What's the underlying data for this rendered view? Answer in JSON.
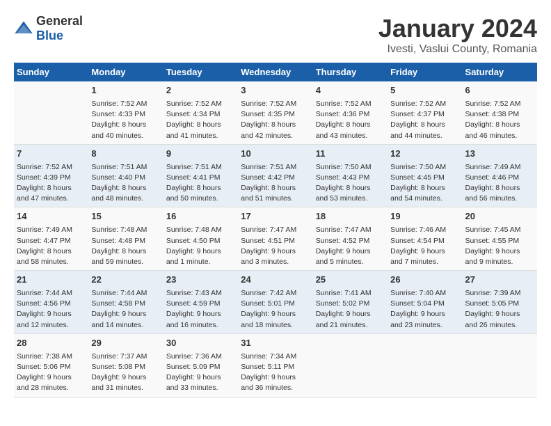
{
  "logo": {
    "general": "General",
    "blue": "Blue"
  },
  "title": "January 2024",
  "subtitle": "Ivesti, Vaslui County, Romania",
  "days_header": [
    "Sunday",
    "Monday",
    "Tuesday",
    "Wednesday",
    "Thursday",
    "Friday",
    "Saturday"
  ],
  "weeks": [
    [
      {
        "day": "",
        "content": ""
      },
      {
        "day": "1",
        "content": "Sunrise: 7:52 AM\nSunset: 4:33 PM\nDaylight: 8 hours\nand 40 minutes."
      },
      {
        "day": "2",
        "content": "Sunrise: 7:52 AM\nSunset: 4:34 PM\nDaylight: 8 hours\nand 41 minutes."
      },
      {
        "day": "3",
        "content": "Sunrise: 7:52 AM\nSunset: 4:35 PM\nDaylight: 8 hours\nand 42 minutes."
      },
      {
        "day": "4",
        "content": "Sunrise: 7:52 AM\nSunset: 4:36 PM\nDaylight: 8 hours\nand 43 minutes."
      },
      {
        "day": "5",
        "content": "Sunrise: 7:52 AM\nSunset: 4:37 PM\nDaylight: 8 hours\nand 44 minutes."
      },
      {
        "day": "6",
        "content": "Sunrise: 7:52 AM\nSunset: 4:38 PM\nDaylight: 8 hours\nand 46 minutes."
      }
    ],
    [
      {
        "day": "7",
        "content": "Sunrise: 7:52 AM\nSunset: 4:39 PM\nDaylight: 8 hours\nand 47 minutes."
      },
      {
        "day": "8",
        "content": "Sunrise: 7:51 AM\nSunset: 4:40 PM\nDaylight: 8 hours\nand 48 minutes."
      },
      {
        "day": "9",
        "content": "Sunrise: 7:51 AM\nSunset: 4:41 PM\nDaylight: 8 hours\nand 50 minutes."
      },
      {
        "day": "10",
        "content": "Sunrise: 7:51 AM\nSunset: 4:42 PM\nDaylight: 8 hours\nand 51 minutes."
      },
      {
        "day": "11",
        "content": "Sunrise: 7:50 AM\nSunset: 4:43 PM\nDaylight: 8 hours\nand 53 minutes."
      },
      {
        "day": "12",
        "content": "Sunrise: 7:50 AM\nSunset: 4:45 PM\nDaylight: 8 hours\nand 54 minutes."
      },
      {
        "day": "13",
        "content": "Sunrise: 7:49 AM\nSunset: 4:46 PM\nDaylight: 8 hours\nand 56 minutes."
      }
    ],
    [
      {
        "day": "14",
        "content": "Sunrise: 7:49 AM\nSunset: 4:47 PM\nDaylight: 8 hours\nand 58 minutes."
      },
      {
        "day": "15",
        "content": "Sunrise: 7:48 AM\nSunset: 4:48 PM\nDaylight: 8 hours\nand 59 minutes."
      },
      {
        "day": "16",
        "content": "Sunrise: 7:48 AM\nSunset: 4:50 PM\nDaylight: 9 hours\nand 1 minute."
      },
      {
        "day": "17",
        "content": "Sunrise: 7:47 AM\nSunset: 4:51 PM\nDaylight: 9 hours\nand 3 minutes."
      },
      {
        "day": "18",
        "content": "Sunrise: 7:47 AM\nSunset: 4:52 PM\nDaylight: 9 hours\nand 5 minutes."
      },
      {
        "day": "19",
        "content": "Sunrise: 7:46 AM\nSunset: 4:54 PM\nDaylight: 9 hours\nand 7 minutes."
      },
      {
        "day": "20",
        "content": "Sunrise: 7:45 AM\nSunset: 4:55 PM\nDaylight: 9 hours\nand 9 minutes."
      }
    ],
    [
      {
        "day": "21",
        "content": "Sunrise: 7:44 AM\nSunset: 4:56 PM\nDaylight: 9 hours\nand 12 minutes."
      },
      {
        "day": "22",
        "content": "Sunrise: 7:44 AM\nSunset: 4:58 PM\nDaylight: 9 hours\nand 14 minutes."
      },
      {
        "day": "23",
        "content": "Sunrise: 7:43 AM\nSunset: 4:59 PM\nDaylight: 9 hours\nand 16 minutes."
      },
      {
        "day": "24",
        "content": "Sunrise: 7:42 AM\nSunset: 5:01 PM\nDaylight: 9 hours\nand 18 minutes."
      },
      {
        "day": "25",
        "content": "Sunrise: 7:41 AM\nSunset: 5:02 PM\nDaylight: 9 hours\nand 21 minutes."
      },
      {
        "day": "26",
        "content": "Sunrise: 7:40 AM\nSunset: 5:04 PM\nDaylight: 9 hours\nand 23 minutes."
      },
      {
        "day": "27",
        "content": "Sunrise: 7:39 AM\nSunset: 5:05 PM\nDaylight: 9 hours\nand 26 minutes."
      }
    ],
    [
      {
        "day": "28",
        "content": "Sunrise: 7:38 AM\nSunset: 5:06 PM\nDaylight: 9 hours\nand 28 minutes."
      },
      {
        "day": "29",
        "content": "Sunrise: 7:37 AM\nSunset: 5:08 PM\nDaylight: 9 hours\nand 31 minutes."
      },
      {
        "day": "30",
        "content": "Sunrise: 7:36 AM\nSunset: 5:09 PM\nDaylight: 9 hours\nand 33 minutes."
      },
      {
        "day": "31",
        "content": "Sunrise: 7:34 AM\nSunset: 5:11 PM\nDaylight: 9 hours\nand 36 minutes."
      },
      {
        "day": "",
        "content": ""
      },
      {
        "day": "",
        "content": ""
      },
      {
        "day": "",
        "content": ""
      }
    ]
  ]
}
